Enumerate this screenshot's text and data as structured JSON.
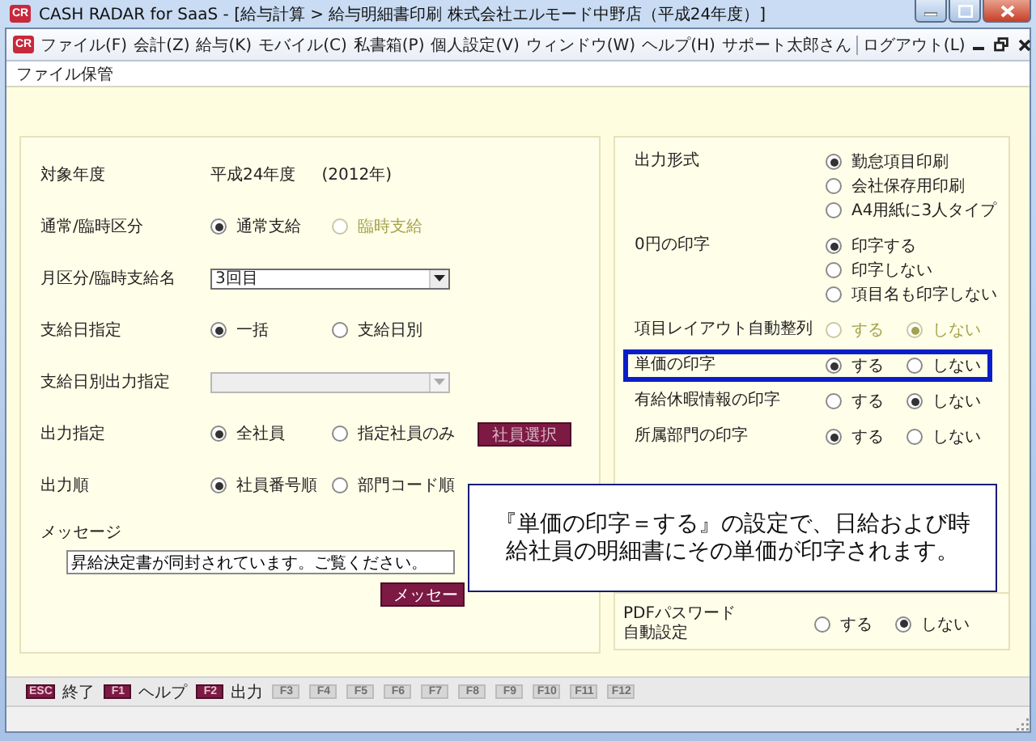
{
  "window": {
    "app_icon": "CR",
    "title": "CASH RADAR for SaaS - [給与計算 > 給与明細書印刷 株式会社エルモード中野店（平成24年度）]"
  },
  "menu": {
    "icon": "CR",
    "items": [
      "ファイル(F)",
      "会計(Z)",
      "給与(K)",
      "モバイル(C)",
      "私書箱(P)",
      "個人設定(V)",
      "ウィンドウ(W)",
      "ヘルプ(H)"
    ],
    "user": "サポート太郎さん",
    "logout": "ログアウト(L)"
  },
  "tab": "ファイル保管",
  "left_rows": [
    {
      "label": "対象年度",
      "kind": "text",
      "value": "平成24年度",
      "note": "(2012年)"
    },
    {
      "label": "通常/臨時区分",
      "kind": "radio",
      "options": [
        {
          "label": "通常支給",
          "selected": true,
          "disabled": false
        },
        {
          "label": "臨時支給",
          "selected": false,
          "disabled": true
        }
      ]
    },
    {
      "label": "月区分/臨時支給名",
      "kind": "select",
      "value": "3回目",
      "disabled": false
    },
    {
      "label": "支給日指定",
      "kind": "radio",
      "options": [
        {
          "label": "一括",
          "selected": true,
          "disabled": false
        },
        {
          "label": "支給日別",
          "selected": false,
          "disabled": false
        }
      ]
    },
    {
      "label": "支給日別出力指定",
      "kind": "select",
      "disabled": true
    },
    {
      "label": "出力指定",
      "kind": "radio",
      "options": [
        {
          "label": "全社員",
          "selected": true,
          "disabled": false
        },
        {
          "label": "指定社員のみ",
          "selected": false,
          "disabled": false
        }
      ],
      "button": "社員選択"
    },
    {
      "label": "出力順",
      "kind": "radio",
      "options": [
        {
          "label": "社員番号順",
          "selected": true,
          "disabled": false
        },
        {
          "label": "部門コード順",
          "selected": false,
          "disabled": false
        }
      ]
    }
  ],
  "message": {
    "label": "メッセージ",
    "value": "昇給決定書が同封されています。ご覧ください。",
    "button": "メッセー"
  },
  "right_rows": [
    {
      "label": "出力形式",
      "kind": "stack",
      "highlighted": false,
      "options": [
        {
          "label": "勤怠項目印刷",
          "selected": true,
          "disabled": false
        },
        {
          "label": "会社保存用印刷",
          "selected": false,
          "disabled": false
        },
        {
          "label": "A4用紙に3人タイプ",
          "selected": false,
          "disabled": false
        }
      ]
    },
    {
      "label": "0円の印字",
      "kind": "stack",
      "highlighted": false,
      "options": [
        {
          "label": "印字する",
          "selected": true,
          "disabled": false
        },
        {
          "label": "印字しない",
          "selected": false,
          "disabled": false
        },
        {
          "label": "項目名も印字しない",
          "selected": false,
          "disabled": false
        }
      ]
    },
    {
      "label": "項目レイアウト自動整列",
      "kind": "inline",
      "highlighted": false,
      "options": [
        {
          "label": "する",
          "selected": false,
          "disabled": true
        },
        {
          "label": "しない",
          "selected": true,
          "disabled": true
        }
      ]
    },
    {
      "label": "単価の印字",
      "kind": "inline",
      "highlighted": true,
      "options": [
        {
          "label": "する",
          "selected": true,
          "disabled": false
        },
        {
          "label": "しない",
          "selected": false,
          "disabled": false
        }
      ]
    },
    {
      "label": "有給休暇情報の印字",
      "kind": "inline",
      "highlighted": false,
      "options": [
        {
          "label": "する",
          "selected": false,
          "disabled": false
        },
        {
          "label": "しない",
          "selected": true,
          "disabled": false
        }
      ]
    },
    {
      "label": "所属部門の印字",
      "kind": "inline",
      "highlighted": false,
      "options": [
        {
          "label": "する",
          "selected": true,
          "disabled": false
        },
        {
          "label": "しない",
          "selected": false,
          "disabled": false
        }
      ]
    }
  ],
  "pdf_row": {
    "label": "PDFパスワード自動設定",
    "options": [
      {
        "label": "する",
        "selected": false,
        "disabled": false
      },
      {
        "label": "しない",
        "selected": true,
        "disabled": false
      }
    ]
  },
  "callout": "『単価の印字＝する』の設定で、日給および時給社員の明細書にその単価が印字されます。",
  "function_keys": [
    {
      "key": "ESC",
      "label": "終了",
      "disabled": false
    },
    {
      "key": "F1",
      "label": "ヘルプ",
      "disabled": false
    },
    {
      "key": "F2",
      "label": "出力",
      "disabled": false
    },
    {
      "key": "F3",
      "disabled": true
    },
    {
      "key": "F4",
      "disabled": true
    },
    {
      "key": "F5",
      "disabled": true
    },
    {
      "key": "F6",
      "disabled": true
    },
    {
      "key": "F7",
      "disabled": true
    },
    {
      "key": "F8",
      "disabled": true
    },
    {
      "key": "F9",
      "disabled": true
    },
    {
      "key": "F10",
      "disabled": true
    },
    {
      "key": "F11",
      "disabled": true
    },
    {
      "key": "F12",
      "disabled": true
    }
  ]
}
